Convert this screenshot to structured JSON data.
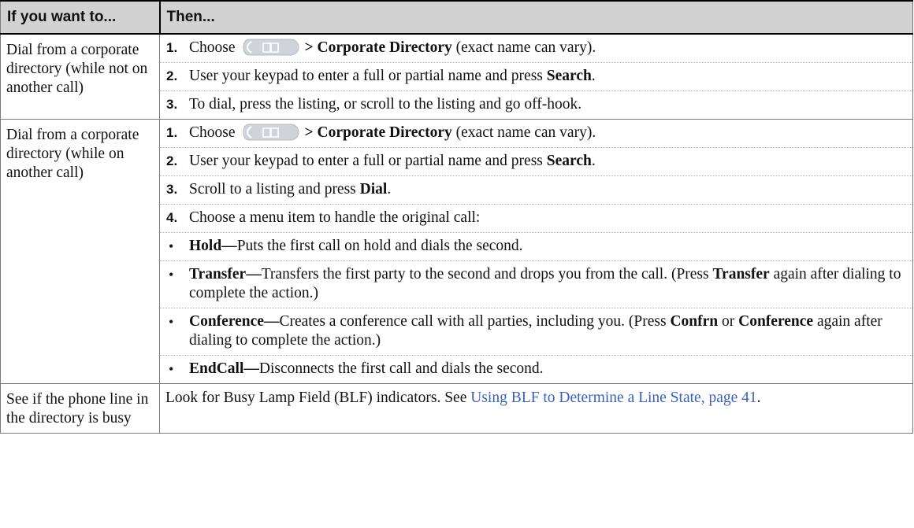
{
  "header": {
    "col1": "If you want to...",
    "col2": "Then..."
  },
  "row1": {
    "desc": "Dial from a corporate directory (while not on another call)",
    "step1": {
      "num": "1.",
      "a": "Choose",
      "b": "> Corporate Directory",
      "c": "(exact name can vary)."
    },
    "step2": {
      "num": "2.",
      "a": "User your keypad to enter a full or partial name and press",
      "b": "Search",
      "c": "."
    },
    "step3": {
      "num": "3.",
      "a": "To dial, press the listing, or scroll to the listing and go off-hook."
    }
  },
  "row2": {
    "desc": "Dial from a corporate directory (while on another call)",
    "step1": {
      "num": "1.",
      "a": "Choose",
      "b": "> Corporate Directory",
      "c": "(exact name can vary)."
    },
    "step2": {
      "num": "2.",
      "a": "User your keypad to enter a full or partial name and press",
      "b": "Search",
      "c": "."
    },
    "step3": {
      "num": "3.",
      "a": "Scroll to a listing and press",
      "b": "Dial",
      "c": "."
    },
    "step4": {
      "num": "4.",
      "a": "Choose a menu item to handle the original call:"
    },
    "bullet1": {
      "b": "Hold—",
      "a": "Puts the first call on hold and dials the second."
    },
    "bullet2": {
      "b": "Transfer—",
      "a": "Transfers the first party to the second and drops you from the call. (Press",
      "c": "Transfer",
      "d": "again after dialing to complete the action.)"
    },
    "bullet3": {
      "b": "Conference—",
      "a": "Creates a conference call with all parties, including you. (Press",
      "c": "Confrn",
      "d": "or",
      "e": "Conference",
      "f": "again after dialing to complete the action.)"
    },
    "bullet4": {
      "b": "EndCall—",
      "a": "Disconnects the first call and dials the second."
    }
  },
  "row3": {
    "desc": "See if the phone line in the directory is busy",
    "text": "Look for Busy Lamp Field (BLF) indicators. See",
    "link": "Using BLF to Determine a Line State, page 41",
    "end": "."
  },
  "icon": {
    "name": "directories-book-icon",
    "bg": "#cfd4da",
    "fg": "#ffffff"
  }
}
